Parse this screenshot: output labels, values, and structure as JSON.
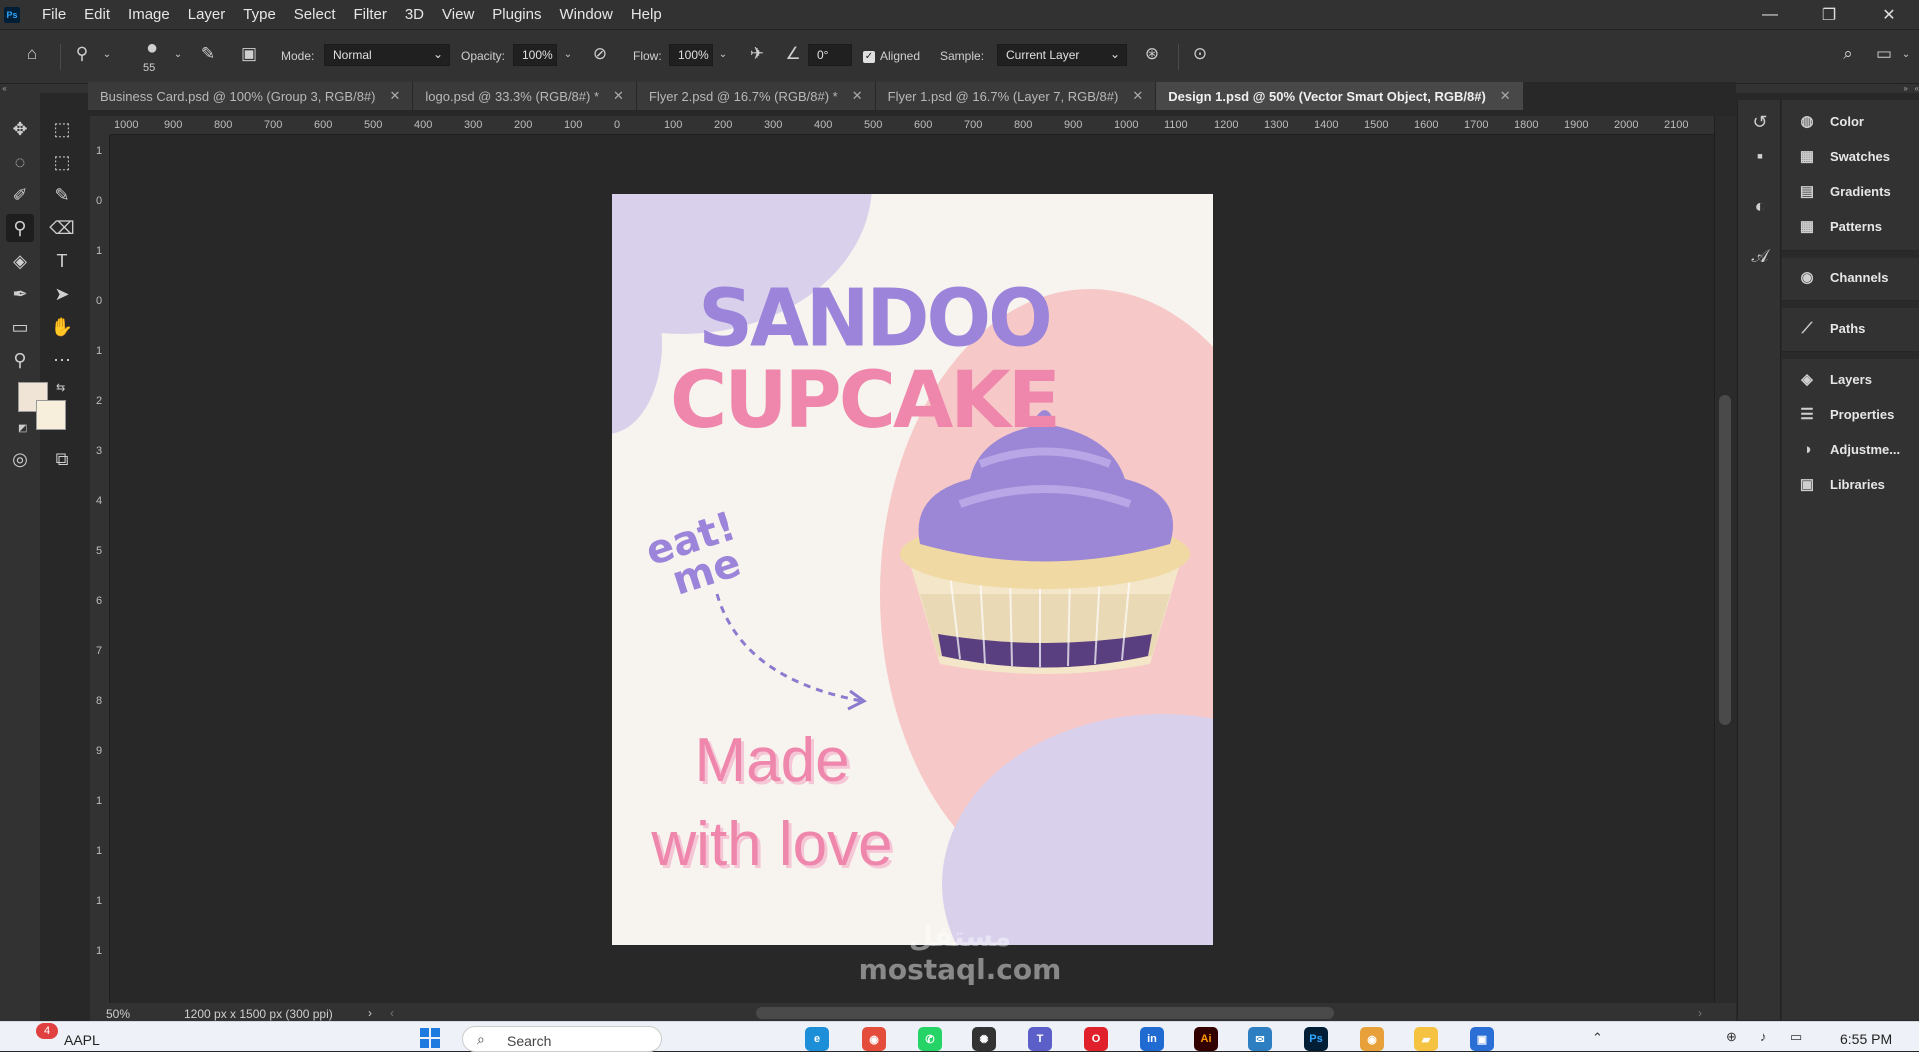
{
  "app": {
    "logo": "Ps",
    "menu": [
      "File",
      "Edit",
      "Image",
      "Layer",
      "Type",
      "Select",
      "Filter",
      "3D",
      "View",
      "Plugins",
      "Window",
      "Help"
    ]
  },
  "options": {
    "brush_size": "55",
    "mode_label": "Mode:",
    "mode_value": "Normal",
    "opacity_label": "Opacity:",
    "opacity_value": "100%",
    "flow_label": "Flow:",
    "flow_value": "100%",
    "angle_value": "0°",
    "aligned_label": "Aligned",
    "sample_label": "Sample:",
    "sample_value": "Current Layer"
  },
  "tabs": [
    {
      "label": "Business Card.psd @ 100% (Group 3, RGB/8#)",
      "active": false
    },
    {
      "label": "logo.psd @ 33.3% (RGB/8#) *",
      "active": false
    },
    {
      "label": "Flyer 2.psd @ 16.7% (RGB/8#) *",
      "active": false
    },
    {
      "label": "Flyer 1.psd @ 16.7% (Layer 7, RGB/8#)",
      "active": false
    },
    {
      "label": "Design 1.psd @ 50% (Vector Smart Object, RGB/8#)",
      "active": true
    }
  ],
  "ruler": {
    "h_ticks": [
      "1000",
      "900",
      "800",
      "700",
      "600",
      "500",
      "400",
      "300",
      "200",
      "100",
      "0",
      "100",
      "200",
      "300",
      "400",
      "500",
      "600",
      "700",
      "800",
      "900",
      "1000",
      "1100",
      "1200",
      "1300",
      "1400",
      "1500",
      "1600",
      "1700",
      "1800",
      "1900",
      "2000",
      "2100"
    ],
    "v_ticks": [
      "1",
      "0",
      "1",
      "0",
      "1",
      "2",
      "3",
      "4",
      "5",
      "6",
      "7",
      "8",
      "9",
      "1",
      "1",
      "1",
      "1"
    ]
  },
  "design": {
    "title": "SANDOO",
    "subtitle": "CUPCAKE",
    "eat_me_line1": "eat!",
    "eat_me_line2": "me",
    "tagline_line1": "Made",
    "tagline_line2": "with love",
    "colors": {
      "lavender": "#9b84d9",
      "pink": "#ef86ac",
      "bg": "#f7f4ef",
      "blob_pink": "#f7c8c8",
      "blob_purple": "#d9d0ec"
    }
  },
  "panels": {
    "group1": [
      "Color",
      "Swatches",
      "Gradients",
      "Patterns"
    ],
    "group2": [
      "Channels"
    ],
    "group3": [
      "Paths"
    ],
    "group4": [
      "Layers",
      "Properties",
      "Adjustme...",
      "Libraries"
    ]
  },
  "status": {
    "zoom": "50%",
    "doc_info": "1200 px x 1500 px (300 ppi)"
  },
  "taskbar": {
    "stock_badge": "4",
    "stock_label": "AAPL",
    "search_placeholder": "Search",
    "time": "6:55 PM"
  },
  "watermark": "مستقل mostaql.com"
}
